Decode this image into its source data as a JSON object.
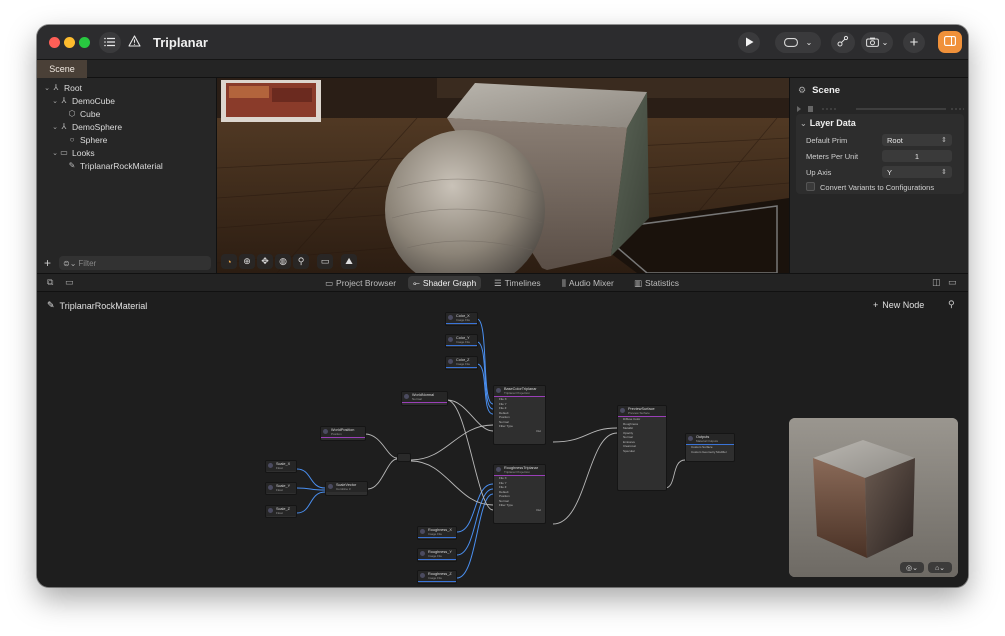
{
  "window": {
    "title": "Triplanar"
  },
  "toolbar": {
    "play_label": "Play",
    "icons": [
      "sidebar-list-icon",
      "warning-icon",
      "play-icon",
      "headset-icon",
      "chevron-down-icon",
      "collab-icon",
      "camera-icon",
      "plus-icon",
      "inspector-icon"
    ]
  },
  "document_tab": {
    "label": "Scene"
  },
  "hierarchy": {
    "items": [
      {
        "label": "Root",
        "depth": 0,
        "icon": "root-icon"
      },
      {
        "label": "DemoCube",
        "depth": 1,
        "icon": "xform-icon"
      },
      {
        "label": "Cube",
        "depth": 2,
        "icon": "cube-icon"
      },
      {
        "label": "DemoSphere",
        "depth": 1,
        "icon": "xform-icon"
      },
      {
        "label": "Sphere",
        "depth": 2,
        "icon": "sphere-icon"
      },
      {
        "label": "Looks",
        "depth": 1,
        "icon": "folder-icon"
      },
      {
        "label": "TriplanarRockMaterial",
        "depth": 2,
        "icon": "material-icon"
      }
    ],
    "filter_placeholder": "Filter",
    "add_label": "+"
  },
  "inspector": {
    "title": "Scene",
    "section": "Layer Data",
    "props": [
      {
        "label": "Default Prim",
        "value": "Root",
        "kind": "popup"
      },
      {
        "label": "Meters Per Unit",
        "value": "1",
        "kind": "number"
      },
      {
        "label": "Up Axis",
        "value": "Y",
        "kind": "popup"
      }
    ],
    "checkbox_label": "Convert Variants to Configurations"
  },
  "bottom_tabs": [
    {
      "label": "Project Browser",
      "icon": "folder-icon",
      "active": false
    },
    {
      "label": "Shader Graph",
      "icon": "graph-icon",
      "active": true
    },
    {
      "label": "Timelines",
      "icon": "timeline-icon",
      "active": false
    },
    {
      "label": "Audio Mixer",
      "icon": "mixer-icon",
      "active": false
    },
    {
      "label": "Statistics",
      "icon": "stats-icon",
      "active": false
    }
  ],
  "graph": {
    "title": "TriplanarRockMaterial",
    "new_node_label": "New Node",
    "nodes": {
      "color_x": {
        "title": "Color_X",
        "sub": "Image File"
      },
      "color_y": {
        "title": "Color_Y",
        "sub": "Image File"
      },
      "color_z": {
        "title": "Color_Z",
        "sub": "Image File"
      },
      "world_normal": {
        "title": "WorldNormal",
        "sub": "Normal"
      },
      "base_color_triplanar": {
        "title": "BaseColorTriplanar",
        "sub": "Triplanar Projection",
        "ports": [
          "File X",
          "File Y",
          "File Z",
          "Default",
          "Position",
          "Normal",
          "Filter Type"
        ],
        "out": "Out"
      },
      "world_position": {
        "title": "WorldPosition",
        "sub": "Position"
      },
      "scale_x": {
        "title": "Scale_X",
        "sub": "Float"
      },
      "scale_y": {
        "title": "Scale_Y",
        "sub": "Float"
      },
      "scale_z": {
        "title": "Scale_Z",
        "sub": "Float"
      },
      "scale_vector": {
        "title": "ScaleVector",
        "sub": "Combine 3"
      },
      "roughness_triplanar": {
        "title": "RoughnessTriplanar",
        "sub": "Triplanar Projection",
        "ports": [
          "File X",
          "File Y",
          "File Z",
          "Default",
          "Position",
          "Normal",
          "Filter Type"
        ],
        "out": "Out"
      },
      "preview_surface": {
        "title": "PreviewSurface",
        "sub": "Preview Surface",
        "ports": [
          "Diffuse Color",
          "Roughness",
          "Metallic",
          "Opacity",
          "Normal",
          "Emissive",
          "Clearcoat",
          "Specular"
        ]
      },
      "outputs": {
        "title": "Outputs",
        "sub": "Material Outputs",
        "ports": [
          "Custom Surface",
          "Custom Geometry Modifier"
        ]
      },
      "roughness_x": {
        "title": "Roughness_X",
        "sub": "Image File"
      },
      "roughness_y": {
        "title": "Roughness_Y",
        "sub": "Image File"
      },
      "roughness_z": {
        "title": "Roughness_Z",
        "sub": "Image File"
      }
    }
  },
  "colors": {
    "accent_orange": "#f0913a",
    "image_node_bar": "#3a74d8",
    "func_node_bar": "#9a3fb8",
    "wire": "#b8b8b8",
    "wire_blue": "#4a8ff0"
  }
}
